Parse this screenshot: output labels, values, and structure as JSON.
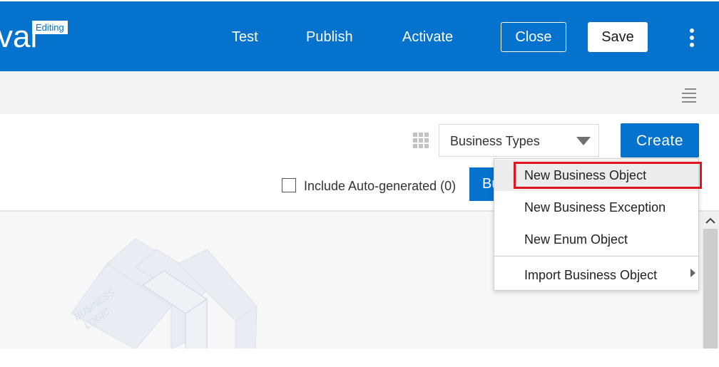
{
  "header": {
    "title_fragment": "val",
    "editing_badge": "Editing",
    "nav": [
      "Test",
      "Publish",
      "Activate"
    ],
    "close_label": "Close",
    "save_label": "Save"
  },
  "toolbar": {
    "types_select_value": "Business Types",
    "create_label": "Create",
    "include_auto_generated_label": "Include Auto-generated (0)",
    "bu_button_label": "Bu"
  },
  "dropdown": {
    "items": [
      {
        "label": "New Business Object",
        "highlighted": true
      },
      {
        "label": "New Business Exception"
      },
      {
        "label": "New Enum Object"
      },
      {
        "label": "Import Business Object",
        "has_submenu": true
      }
    ]
  },
  "illustration": {
    "text_line1": "BUSINESS",
    "text_line2": "LOGIC"
  },
  "icons": [
    "kebab-menu-icon",
    "list-menu-icon",
    "grid-view-icon",
    "dropdown-caret-icon",
    "scroll-up-icon",
    "submenu-arrow-icon"
  ],
  "colors": {
    "brand_blue": "#0572ce",
    "highlight_red": "#e0141e",
    "toolbar_gray": "#f3f3f3"
  }
}
